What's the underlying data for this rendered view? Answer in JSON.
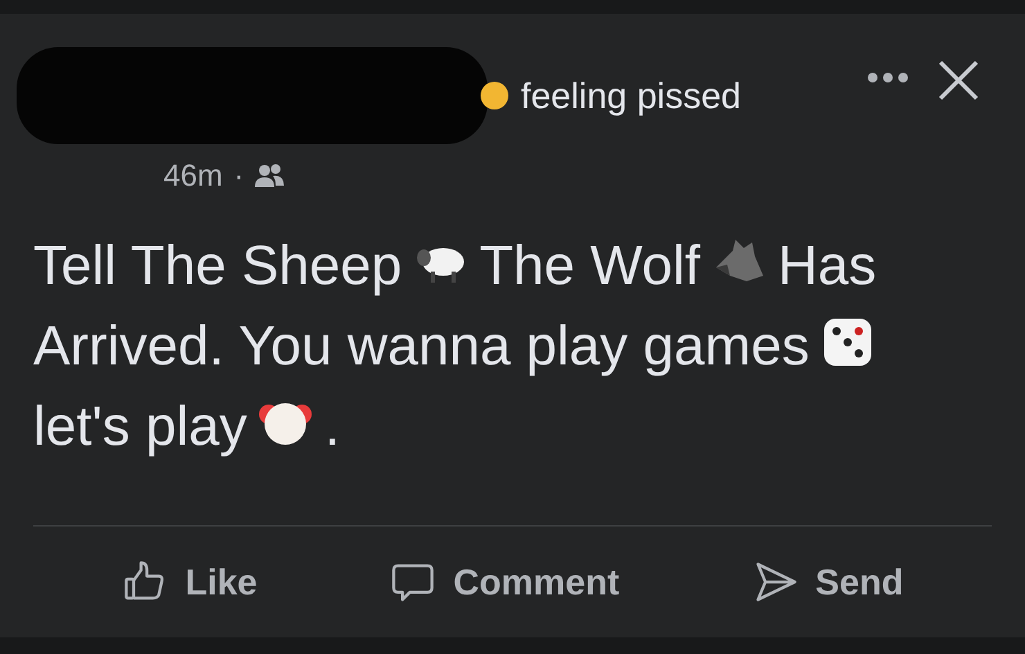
{
  "post": {
    "feeling": "feeling pissed",
    "time": "46m",
    "separator": "·",
    "body": [
      [
        {
          "kind": "text",
          "text": "Tell The Sheep"
        },
        {
          "kind": "sheep"
        },
        {
          "kind": "text",
          "text": "The Wolf"
        },
        {
          "kind": "wolf"
        },
        {
          "kind": "text",
          "text": "Has"
        }
      ],
      [
        {
          "kind": "text",
          "text": "Arrived. You wanna play games"
        },
        {
          "kind": "dice"
        }
      ],
      [
        {
          "kind": "text",
          "text": "let's play"
        },
        {
          "kind": "clown"
        },
        {
          "kind": "text",
          "text": "."
        }
      ]
    ]
  },
  "actions": [
    {
      "kind": "like",
      "label": "Like"
    },
    {
      "kind": "comment",
      "label": "Comment"
    },
    {
      "kind": "send",
      "label": "Send"
    }
  ]
}
